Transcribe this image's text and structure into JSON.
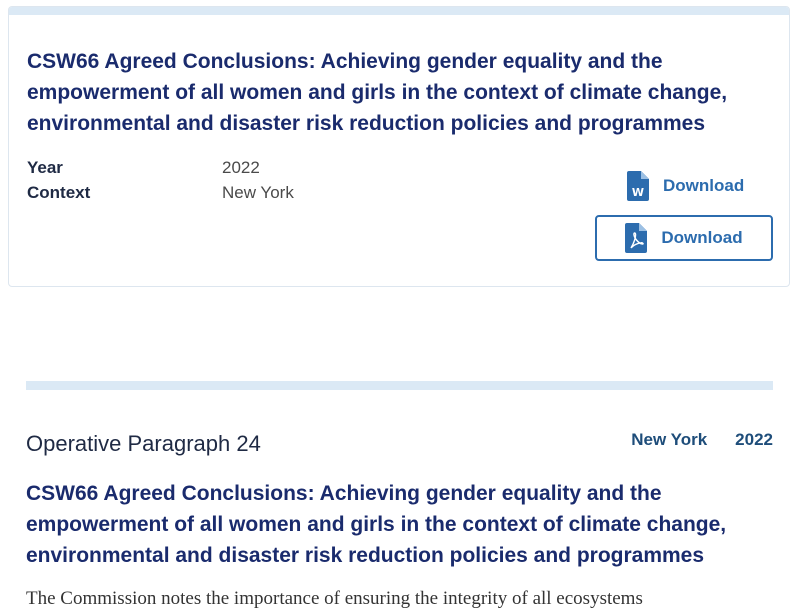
{
  "document_card": {
    "title": "CSW66 Agreed Conclusions: Achieving gender equality and the empowerment of all women and girls in the context of climate change, environmental and disaster risk reduction policies and programmes",
    "meta": [
      {
        "label": "Year",
        "value": "2022"
      },
      {
        "label": "Context",
        "value": "New York"
      }
    ],
    "downloads": {
      "word": {
        "label": "Download",
        "icon": "word-file-icon"
      },
      "pdf": {
        "label": "Download",
        "icon": "pdf-file-icon"
      }
    }
  },
  "paragraph": {
    "heading": "Operative Paragraph 24",
    "location": "New York",
    "year": "2022",
    "title": "CSW66 Agreed Conclusions: Achieving gender equality and the empowerment of all women and girls in the context of climate change, environmental and disaster risk reduction policies and programmes",
    "text": "The Commission notes the importance of ensuring the integrity of all ecosystems"
  },
  "colors": {
    "title": "#1a2b6d",
    "accent": "#2c6cae",
    "bar": "#dbe9f5"
  }
}
